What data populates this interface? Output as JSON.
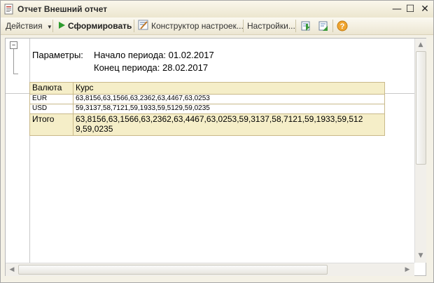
{
  "window": {
    "title": "Отчет  Внешний отчет",
    "controls": {
      "minimize": "—",
      "maximize": "☐",
      "close": "✕"
    }
  },
  "toolbar": {
    "actions_label": "Действия",
    "generate_label": "Сформировать",
    "settings_designer_label": "Конструктор настроек...",
    "settings_label": "Настройки...",
    "icons": [
      "save-settings-icon",
      "restore-settings-icon",
      "help-icon"
    ]
  },
  "report": {
    "params_label": "Параметры:",
    "period_start": "Начало периода: 01.02.2017",
    "period_end": "Конец периода: 28.02.2017",
    "table": {
      "headers": [
        "Валюта",
        "Курс"
      ],
      "rows": [
        {
          "currency": "EUR",
          "rate": "63,8156,63,1566,63,2362,63,4467,63,0253"
        },
        {
          "currency": "USD",
          "rate": "59,3137,58,7121,59,1933,59,5129,59,0235"
        }
      ],
      "total": {
        "label": "Итого",
        "line1": "63,8156,63,1566,63,2362,63,4467,63,0253,59,3137,58,7121,59,1933,59,512",
        "line2": "9,59,0235"
      }
    }
  },
  "colors": {
    "header_bg": "#f5eec8",
    "border": "#c9b98a",
    "window_bg": "#f4f1e6"
  }
}
